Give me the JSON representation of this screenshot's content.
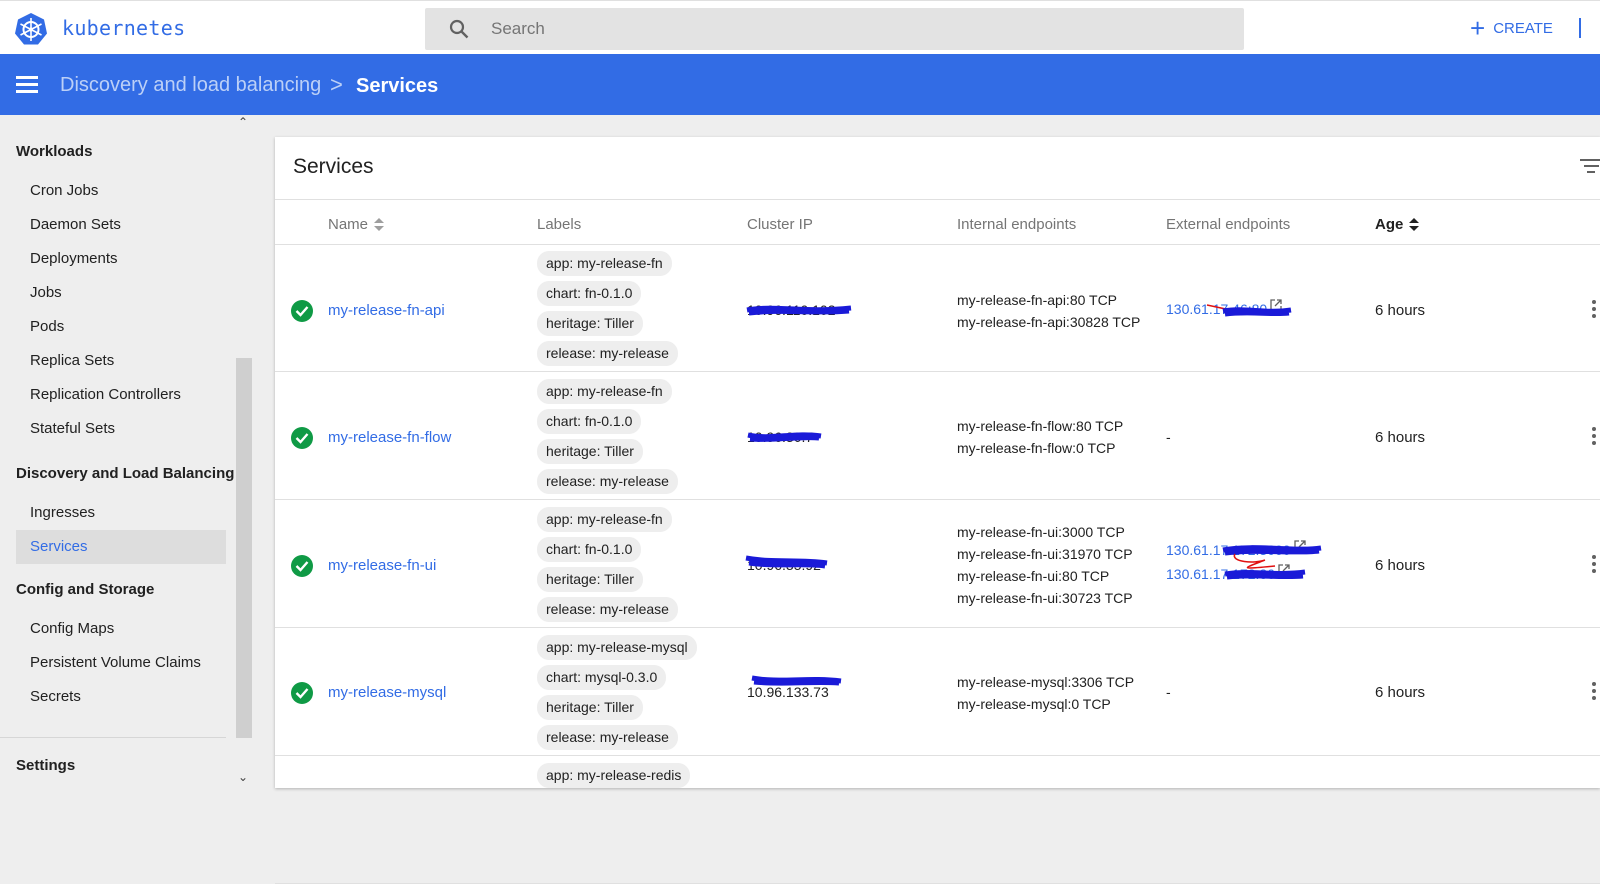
{
  "app": {
    "logo_text": "kubernetes",
    "brand_color": "#326ce5"
  },
  "search": {
    "placeholder": "Search",
    "value": ""
  },
  "actions": {
    "create_label": "CREATE"
  },
  "breadcrumb": {
    "parent": "Discovery and load balancing",
    "separator": ">",
    "current": "Services"
  },
  "sidebar": {
    "sections": [
      {
        "title": "Workloads",
        "items": [
          "Cron Jobs",
          "Daemon Sets",
          "Deployments",
          "Jobs",
          "Pods",
          "Replica Sets",
          "Replication Controllers",
          "Stateful Sets"
        ]
      },
      {
        "title": "Discovery and Load Balancing",
        "items": [
          "Ingresses",
          "Services"
        ]
      },
      {
        "title": "Config and Storage",
        "items": [
          "Config Maps",
          "Persistent Volume Claims",
          "Secrets"
        ]
      },
      {
        "title": "Settings",
        "items": []
      }
    ],
    "active_item": "Services"
  },
  "card": {
    "title": "Services"
  },
  "table": {
    "columns": [
      "Name",
      "Labels",
      "Cluster IP",
      "Internal endpoints",
      "External endpoints",
      "Age"
    ],
    "rows": [
      {
        "status": "ok",
        "name": "my-release-fn-api",
        "labels": [
          "app: my-release-fn",
          "chart: fn-0.1.0",
          "heritage: Tiller",
          "release: my-release"
        ],
        "cluster_ip": "10.96.110.102",
        "internal": [
          "my-release-fn-api:80 TCP",
          "my-release-fn-api:30828 TCP"
        ],
        "external": [
          "130.61.17.46:80"
        ],
        "age": "6 hours"
      },
      {
        "status": "ok",
        "name": "my-release-fn-flow",
        "labels": [
          "app: my-release-fn",
          "chart: fn-0.1.0",
          "heritage: Tiller",
          "release: my-release"
        ],
        "cluster_ip": "10.96.30.7",
        "internal": [
          "my-release-fn-flow:80 TCP",
          "my-release-fn-flow:0 TCP"
        ],
        "external_text": "-",
        "age": "6 hours"
      },
      {
        "status": "ok",
        "name": "my-release-fn-ui",
        "labels": [
          "app: my-release-fn",
          "chart: fn-0.1.0",
          "heritage: Tiller",
          "release: my-release"
        ],
        "cluster_ip": "10.96.35.92",
        "internal": [
          "my-release-fn-ui:3000 TCP",
          "my-release-fn-ui:31970 TCP",
          "my-release-fn-ui:80 TCP",
          "my-release-fn-ui:30723 TCP"
        ],
        "external": [
          "130.61.17.172:3000",
          "130.61.17.172:80"
        ],
        "age": "6 hours"
      },
      {
        "status": "ok",
        "name": "my-release-mysql",
        "labels": [
          "app: my-release-mysql",
          "chart: mysql-0.3.0",
          "heritage: Tiller",
          "release: my-release"
        ],
        "cluster_ip": "10.96.133.73",
        "internal": [
          "my-release-mysql:3306 TCP",
          "my-release-mysql:0 TCP"
        ],
        "external_text": "-",
        "age": "6 hours"
      },
      {
        "status": "ok",
        "name": "",
        "labels": [
          "app: my-release-redis"
        ],
        "age": ""
      }
    ]
  }
}
